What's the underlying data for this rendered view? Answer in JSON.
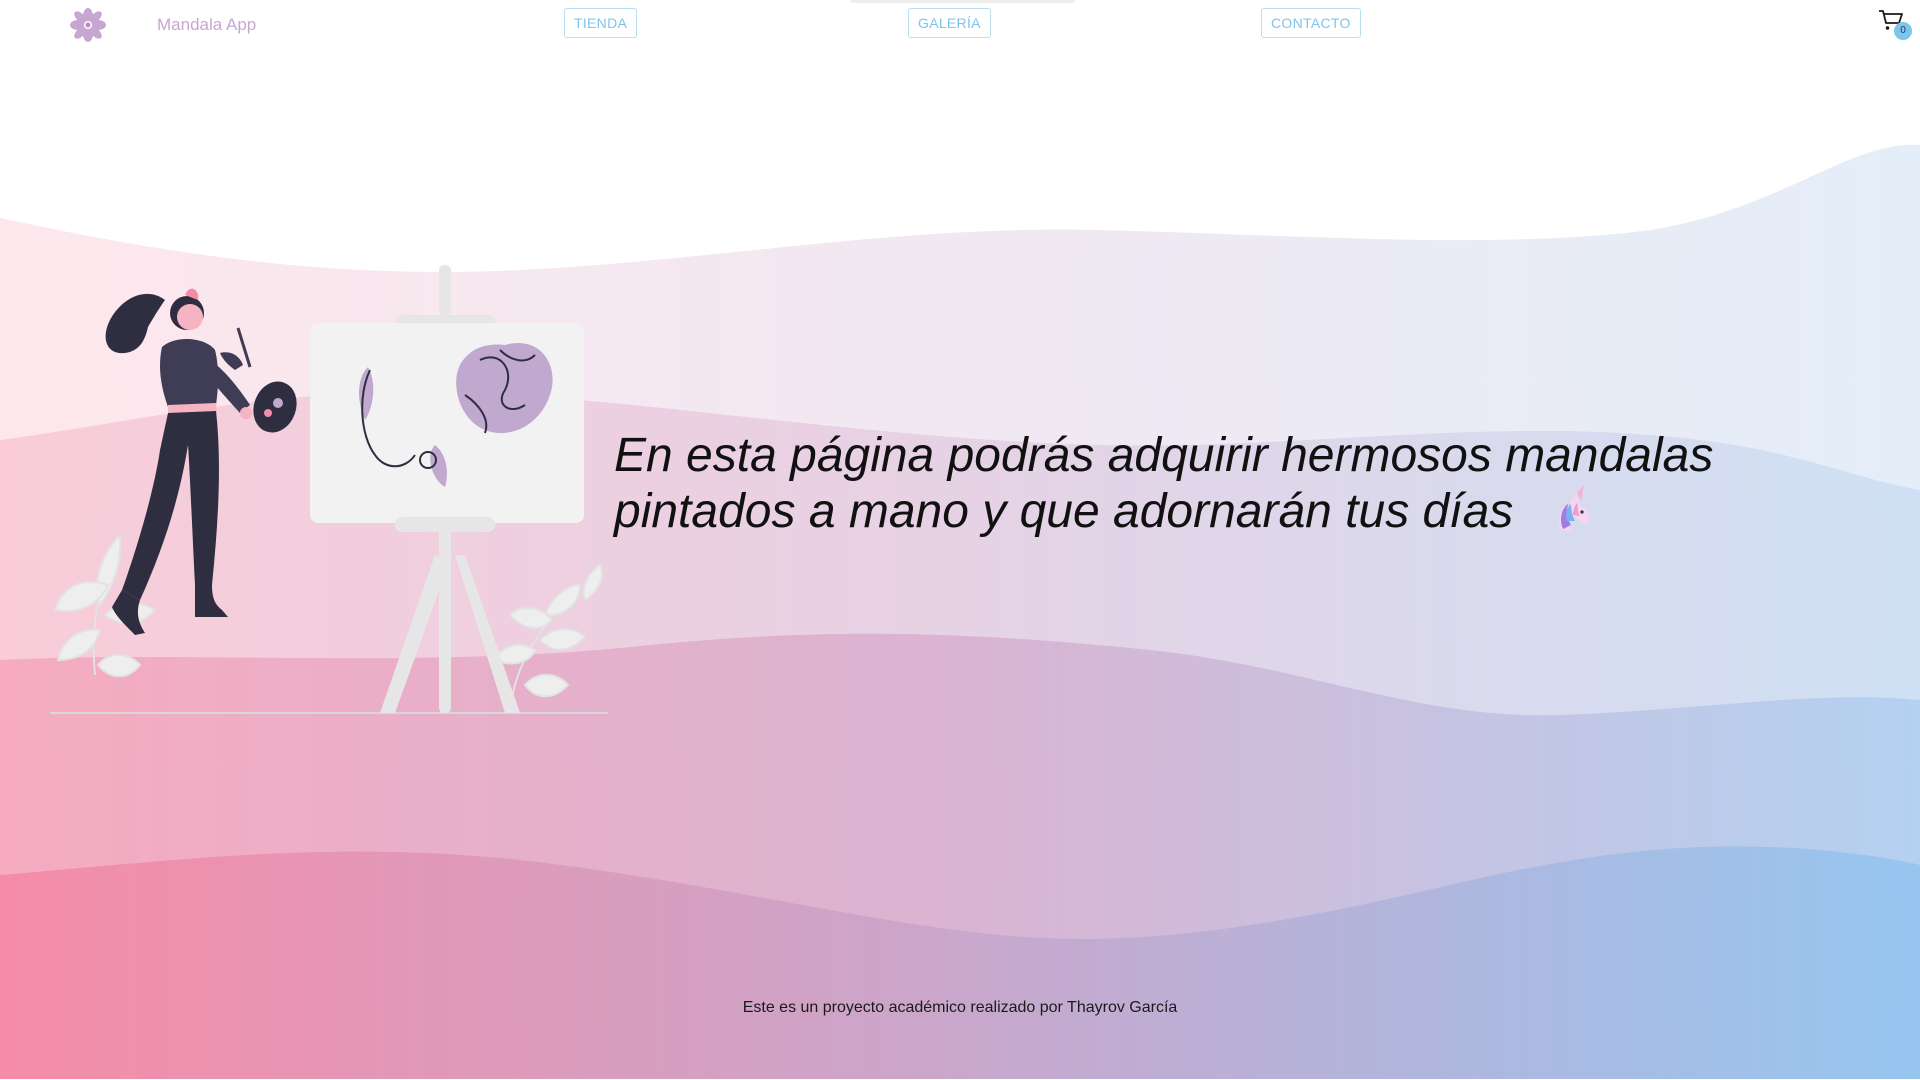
{
  "navbar": {
    "brand_name": "Mandala App",
    "links": [
      {
        "label": "TIENDA"
      },
      {
        "label": "GALERÍA"
      },
      {
        "label": "CONTACTO"
      }
    ],
    "cart": {
      "count": "0",
      "icon": "cart-icon"
    }
  },
  "hero": {
    "text": "En esta página podrás adquirir hermosos mandalas pintados a mano y que adornarán tus días",
    "emoji_icon": "unicorn-icon",
    "illustration_icon": "woman-painting-illustration"
  },
  "footer": {
    "text": "Este es un proyecto académico realizado por Thayrov García"
  },
  "colors": {
    "brand_purple": "#c7a6d1",
    "nav_blue": "#7cc5ec",
    "wave_pink": "#f48ca7",
    "wave_blue": "#96c6f0"
  }
}
